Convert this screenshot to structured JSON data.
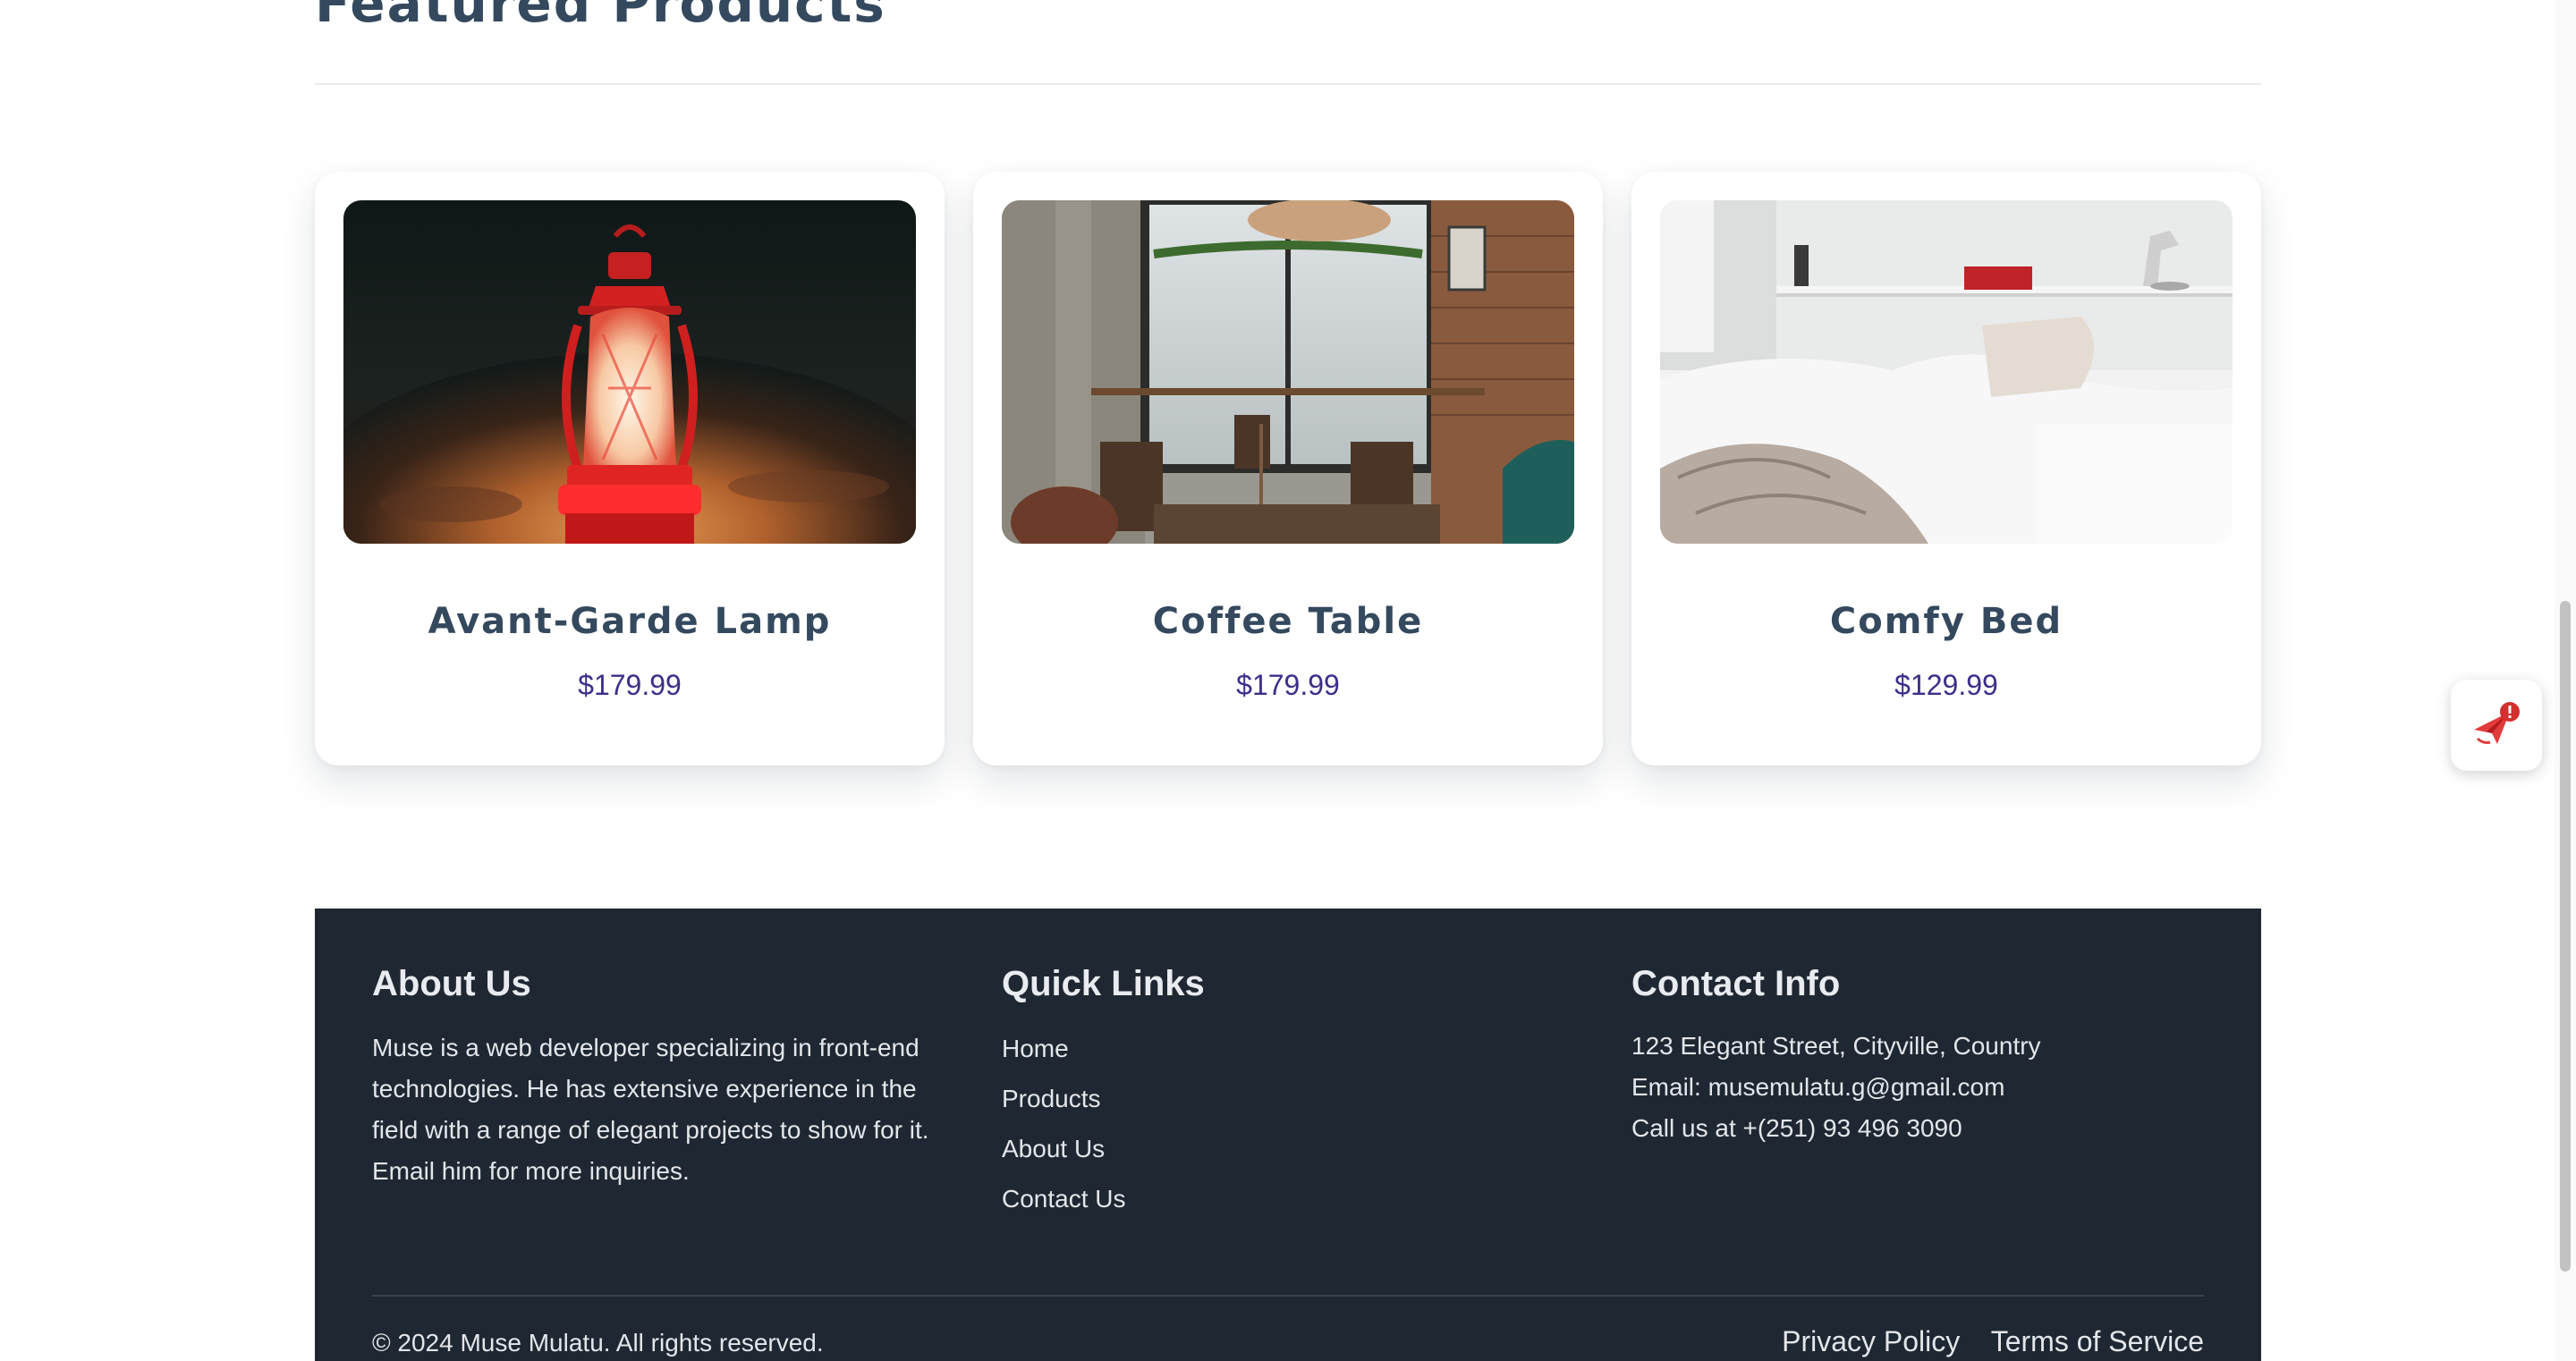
{
  "featured": {
    "title": "Featured Products"
  },
  "products": [
    {
      "name": "Avant-Garde Lamp",
      "price": "$179.99",
      "image": "red-lantern-photo"
    },
    {
      "name": "Coffee Table",
      "price": "$179.99",
      "image": "cafe-interior-photo"
    },
    {
      "name": "Comfy Bed",
      "price": "$129.99",
      "image": "white-bedroom-photo"
    }
  ],
  "footer": {
    "about": {
      "title": "About Us",
      "text": "Muse is a web developer specializing in front-end technologies. He has extensive experience in the field with a range of elegant projects to show for it. Email him for more inquiries."
    },
    "quick_links": {
      "title": "Quick Links",
      "items": [
        "Home",
        "Products",
        "About Us",
        "Contact Us"
      ]
    },
    "contact": {
      "title": "Contact Info",
      "address": "123 Elegant Street, Cityville, Country",
      "email": "Email: musemulatu.g@gmail.com",
      "phone": "Call us at +(251) 93 496 3090"
    },
    "copyright": "© 2024 Muse Mulatu. All rights reserved.",
    "legal": [
      "Privacy Policy",
      "Terms of Service"
    ]
  },
  "widget": {
    "icon": "paper-plane-alert-icon"
  },
  "colors": {
    "heading": "#34495e",
    "price": "#3d2e8a",
    "footer_bg": "#1f2732"
  }
}
